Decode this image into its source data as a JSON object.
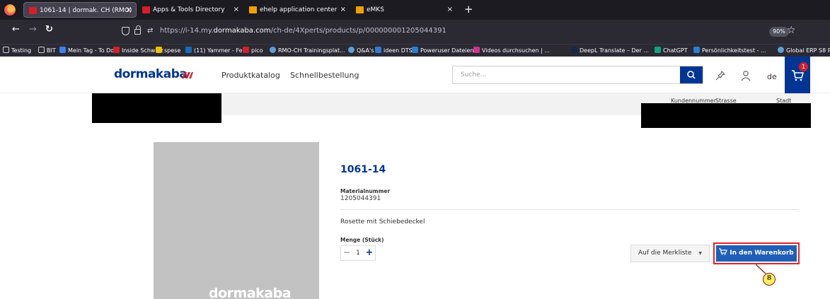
{
  "browser": {
    "tabs": [
      {
        "label": "1061-14 | dormak. CH (RMO)",
        "active": true,
        "favicon_color": "#d81e27"
      },
      {
        "label": "Apps & Tools Directory",
        "active": false,
        "favicon_color": "#d81e27"
      },
      {
        "label": "ehelp application center",
        "active": false,
        "favicon_color": "#f0a000"
      },
      {
        "label": "eMKS",
        "active": false,
        "favicon_color": "#f0a000"
      }
    ],
    "close_glyph": "×",
    "new_tab_glyph": "+",
    "url_prefix": "https://i-14.my.",
    "url_domain": "dormakaba.com",
    "url_suffix": "/ch-de/4Xperts/products/p/000000001205044391",
    "zoom": "90%",
    "bookmarks": [
      {
        "label": "Testing",
        "color": "#cfcfcf"
      },
      {
        "label": "BIT",
        "color": "#cfcfcf"
      },
      {
        "label": "Mein Tag - To Do",
        "color": "#3b82f6"
      },
      {
        "label": "Inside Schweiz",
        "color": "#d81e27"
      },
      {
        "label": "spese",
        "color": "#f0c000"
      },
      {
        "label": "(11) Yammer - Feed",
        "color": "#106ebe"
      },
      {
        "label": "pico",
        "color": "#d81e27"
      },
      {
        "label": "RMO-CH Trainingsplat...",
        "color": "#5aa0d8"
      },
      {
        "label": "Q&A's",
        "color": "#5aa0d8"
      },
      {
        "label": "ideen DTS",
        "color": "#2a7fd4"
      },
      {
        "label": "Poweruser Dateien",
        "color": "#2a7fd4"
      },
      {
        "label": "Videos durchsuchen | ...",
        "color": "#d0328e"
      },
      {
        "label": "DeepL Translate – Der ...",
        "color": "#0f2b46"
      },
      {
        "label": "ChatGPT",
        "color": "#10a37f"
      },
      {
        "label": "Persönlichkeitstest - ...",
        "color": "#2a7fd4"
      },
      {
        "label": "Global ERP S8 Ro",
        "color": "#5aa0d8"
      }
    ]
  },
  "site": {
    "logo": "dormakaba",
    "nav": [
      "Produktkatalog",
      "Schnellbestellung"
    ],
    "search_placeholder": "Suche...",
    "lang": "de",
    "cart_count": "1"
  },
  "customer_bar": {
    "columns": [
      "Kundennummer",
      "Strasse",
      "Stadt"
    ]
  },
  "product": {
    "image_logo": "dormakaba",
    "title": "1061-14",
    "material_label": "Materialnummer",
    "material_number": "1205044391",
    "description": "Rosette mit Schiebedeckel",
    "quantity_label": "Menge (Stück)",
    "quantity": "1",
    "minus_glyph": "−",
    "plus_glyph": "+",
    "wishlist_label": "Auf die Merkliste",
    "cart_label": "In den Warenkorb"
  },
  "annotation": {
    "step": "8"
  }
}
